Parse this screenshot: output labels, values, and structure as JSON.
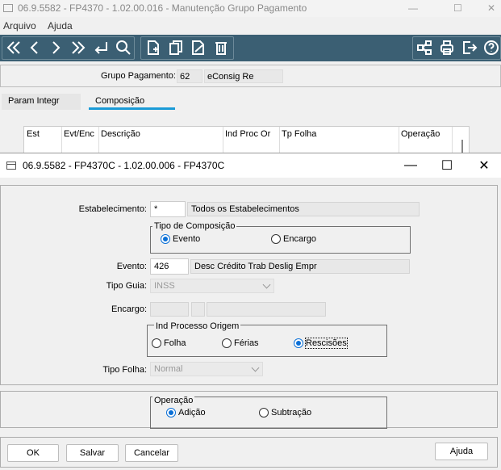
{
  "main_window": {
    "title": "06.9.5582 - FP4370 - 1.02.00.016 - Manutenção Grupo Pagamento",
    "menu": [
      "Arquivo",
      "Ajuda"
    ],
    "grupo_label": "Grupo Pagamento:",
    "grupo_code": "62",
    "grupo_desc": "eConsig Re",
    "tabs": [
      "Param Integr",
      "Composição"
    ],
    "columns": [
      "Est",
      "Evt/Enc",
      "Descrição",
      "Ind Proc Or",
      "Tp Folha",
      "Operação"
    ],
    "toolbar_color": "#3b5f73"
  },
  "dialog": {
    "title": "06.9.5582 - FP4370C - 1.02.00.006 - FP4370C",
    "estabelecimento_label": "Estabelecimento:",
    "estabelecimento_value": "*",
    "estabelecimento_desc": "Todos os Estabelecimentos",
    "tipo_comp_label": "Tipo de Composição",
    "tipo_comp_options": [
      "Evento",
      "Encargo"
    ],
    "evento_label": "Evento:",
    "evento_value": "426",
    "evento_desc": "Desc Crédito Trab Deslig Empr",
    "tipo_guia_label": "Tipo Guia:",
    "tipo_guia_value": "INSS",
    "encargo_label": "Encargo:",
    "ind_proc_label": "Ind Processo Origem",
    "ind_proc_options": [
      "Folha",
      "Férias",
      "Rescisões"
    ],
    "tipo_folha_label": "Tipo Folha:",
    "tipo_folha_value": "Normal",
    "operacao_label": "Operação",
    "operacao_options": [
      "Adição",
      "Subtração"
    ],
    "buttons": {
      "ok": "OK",
      "salvar": "Salvar",
      "cancelar": "Cancelar",
      "ajuda": "Ajuda"
    },
    "accent_color": "#0a6fd6"
  }
}
